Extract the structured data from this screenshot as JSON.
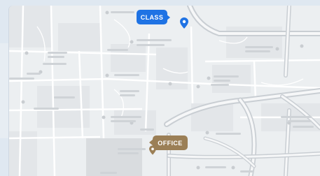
{
  "map": {
    "pins": [
      {
        "id": "class",
        "label": "CLASS",
        "color": "#1f73e4"
      },
      {
        "id": "office",
        "label": "OFFICE",
        "color": "#9b7f56"
      }
    ],
    "palette": {
      "background": "#eceff1",
      "road": "#ffffff",
      "major_road": "#c9ced3",
      "block": "#e4e7ea",
      "poi": "#c9cdd1"
    }
  }
}
